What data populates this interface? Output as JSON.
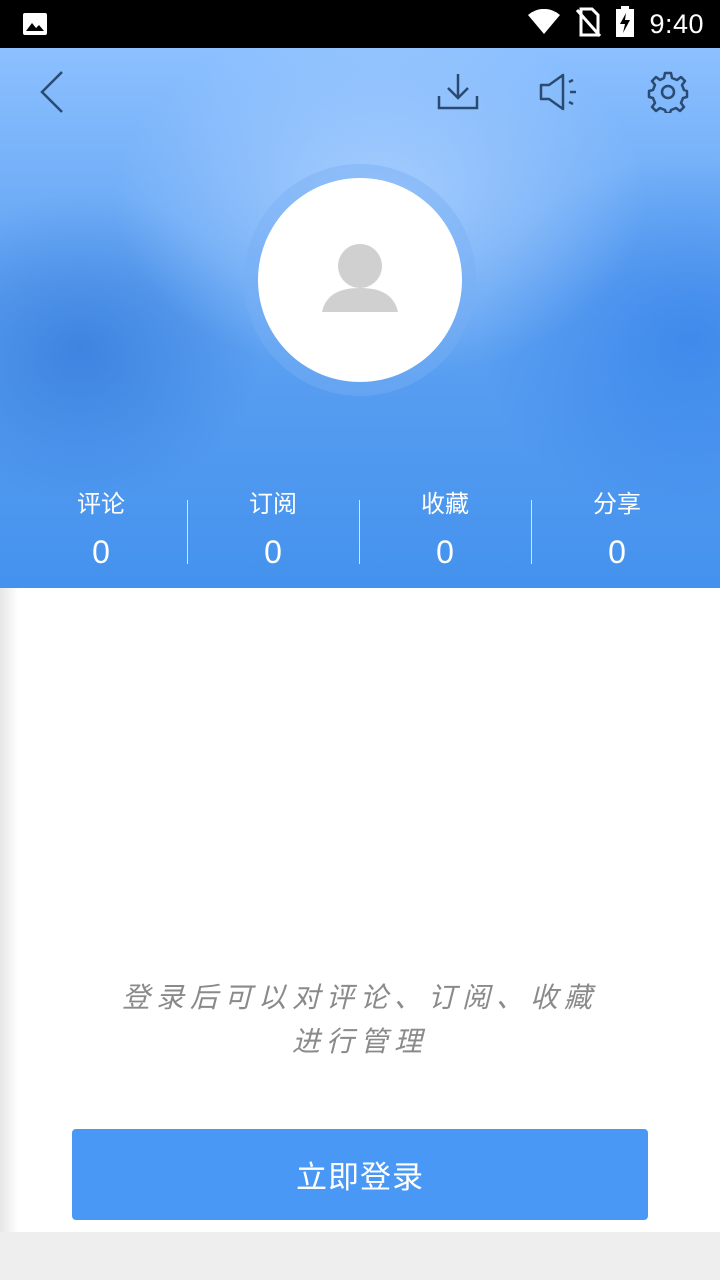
{
  "status_bar": {
    "time": "9:40",
    "icons": [
      "image-icon",
      "wifi-icon",
      "no-sim-icon",
      "battery-charging-icon"
    ]
  },
  "header": {
    "toolbar_icons": [
      "back-icon",
      "download-icon",
      "speaker-icon",
      "settings-icon"
    ],
    "avatar_icon": "user-placeholder-icon",
    "stats": [
      {
        "label": "评论",
        "value": "0"
      },
      {
        "label": "订阅",
        "value": "0"
      },
      {
        "label": "收藏",
        "value": "0"
      },
      {
        "label": "分享",
        "value": "0"
      }
    ]
  },
  "content": {
    "hint_line1": "登录后可以对评论、订阅、收藏",
    "hint_line2": "进行管理",
    "login_button": "立即登录"
  },
  "colors": {
    "header_blue": "#4492ee",
    "button_blue": "#4a98f6",
    "hint_gray": "#8a8a8a",
    "avatar_gray": "#d0d0d0"
  }
}
